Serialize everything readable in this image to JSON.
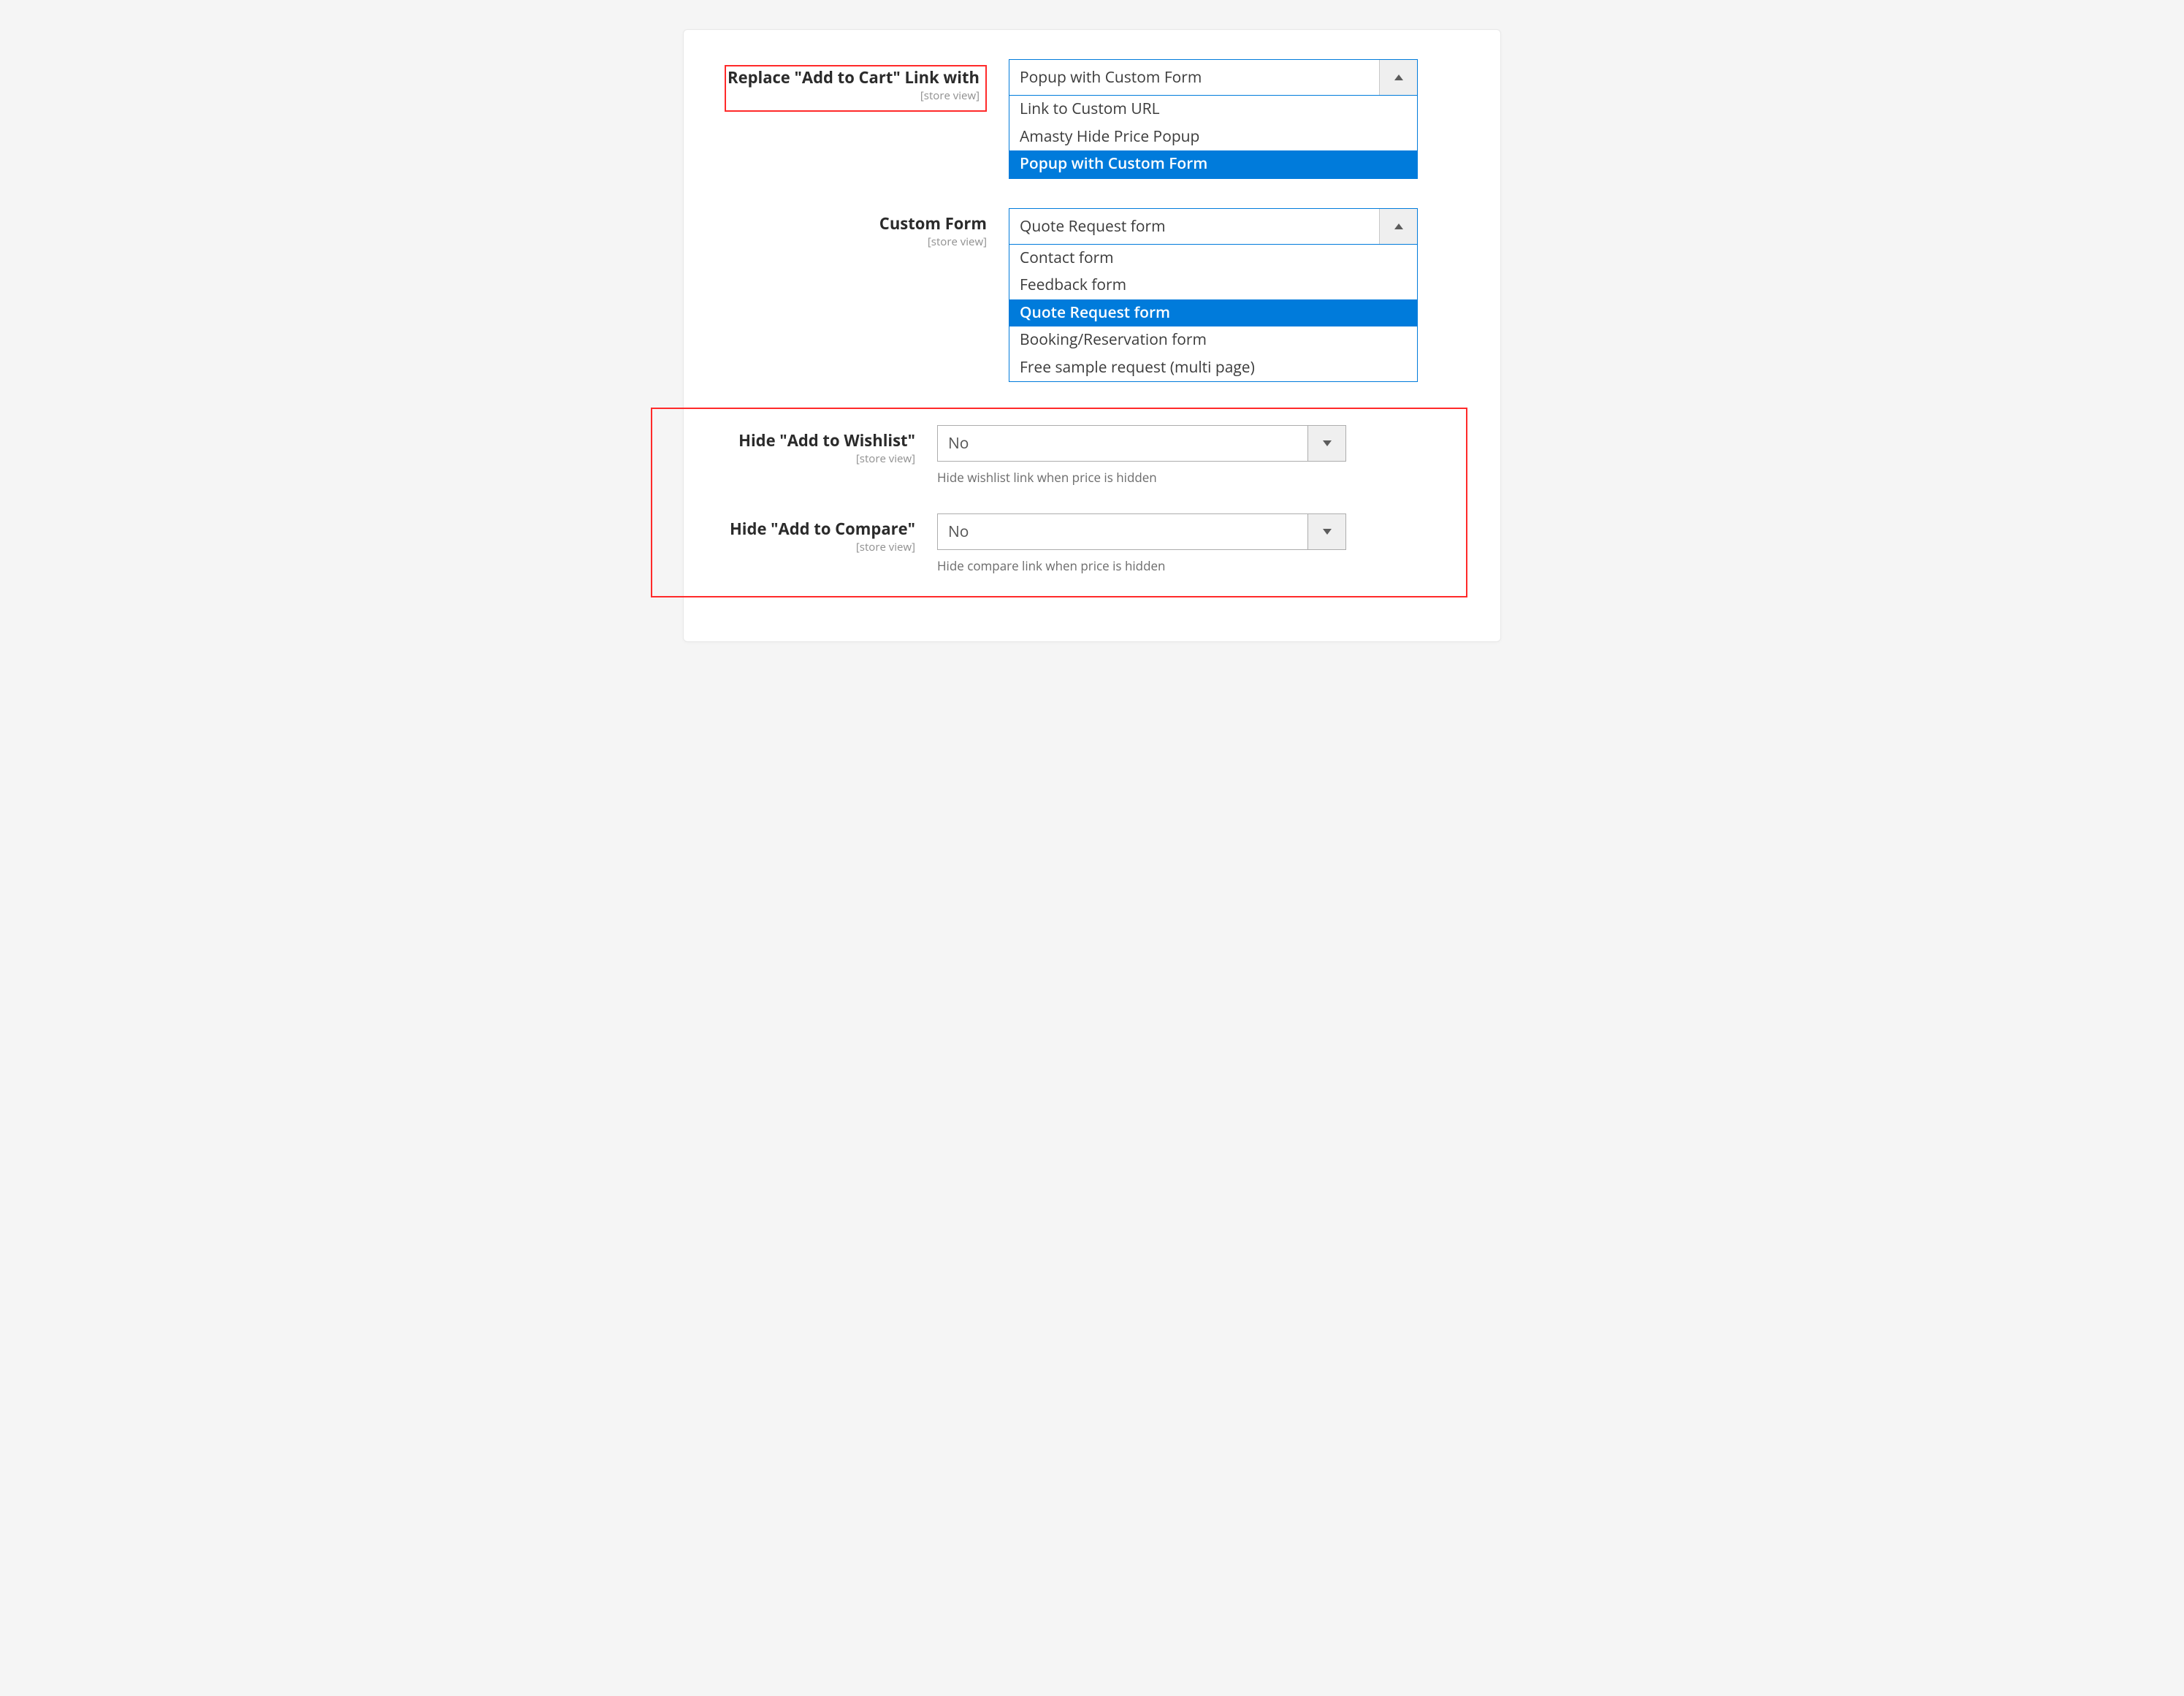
{
  "fields": {
    "replace_link": {
      "label": "Replace \"Add to Cart\" Link with",
      "scope": "[store view]",
      "value": "Popup with Custom Form",
      "options": [
        "Link to Custom URL",
        "Amasty Hide Price Popup",
        "Popup with Custom Form"
      ],
      "selected_index": 2
    },
    "custom_form": {
      "label": "Custom Form",
      "scope": "[store view]",
      "value": "Quote Request form",
      "options": [
        "Contact form",
        "Feedback form",
        "Quote Request form",
        "Booking/Reservation form",
        "Free sample request (multi page)"
      ],
      "selected_index": 2
    },
    "hide_wishlist": {
      "label": "Hide \"Add to Wishlist\"",
      "scope": "[store view]",
      "value": "No",
      "hint": "Hide wishlist link when price is hidden"
    },
    "hide_compare": {
      "label": "Hide \"Add to Compare\"",
      "scope": "[store view]",
      "value": "No",
      "hint": "Hide compare link when price is hidden"
    }
  }
}
